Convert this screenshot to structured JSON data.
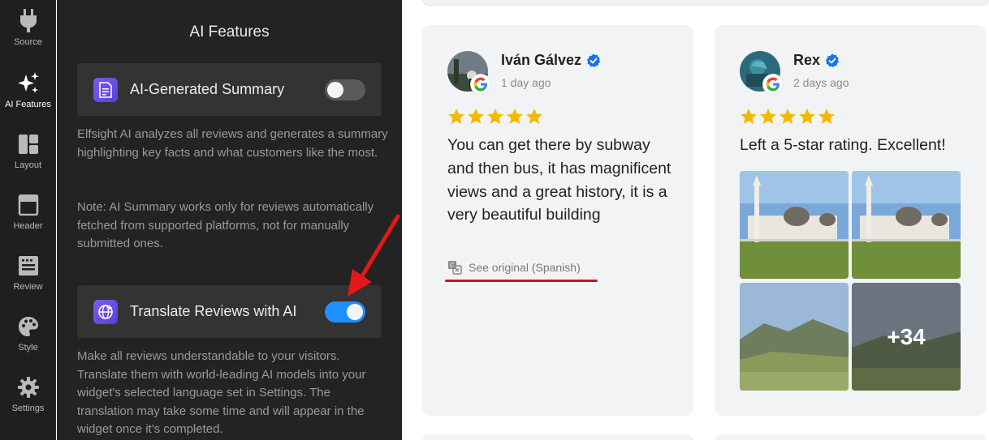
{
  "sidebar": {
    "items": [
      {
        "label": "Source",
        "icon": "plug-icon"
      },
      {
        "label": "AI Features",
        "icon": "sparkles-icon",
        "active": true
      },
      {
        "label": "Layout",
        "icon": "layout-grid-icon"
      },
      {
        "label": "Header",
        "icon": "header-window-icon"
      },
      {
        "label": "Review",
        "icon": "review-list-icon"
      },
      {
        "label": "Style",
        "icon": "palette-icon"
      },
      {
        "label": "Settings",
        "icon": "gear-icon"
      }
    ]
  },
  "panel": {
    "title": "AI Features",
    "features": [
      {
        "label": "AI-Generated Summary",
        "icon": "document-sparkle-icon",
        "enabled": false,
        "description": "Elfsight AI analyzes all reviews and generates a summary highlighting key facts and what customers like the most.",
        "note": "Note: AI Summary works only for reviews automatically fetched from supported platforms, not for manually submitted ones."
      },
      {
        "label": "Translate Reviews with AI",
        "icon": "globe-sparkle-icon",
        "enabled": true,
        "description": "Make all reviews understandable to your visitors. Translate them with world-leading AI models into your widget's selected language set in Settings. The translation may take some time and will appear in the widget once it's completed."
      }
    ]
  },
  "reviews": [
    {
      "name": "Iván Gálvez",
      "date": "1 day ago",
      "rating": 5,
      "text": "You can get there by subway and then bus, it has magnificent views and a great history, it is a very beautiful building",
      "see_original": "See original (Spanish)",
      "source_icon": "google-icon"
    },
    {
      "name": "Rex",
      "date": "2 days ago",
      "rating": 5,
      "text": "Left a 5-star rating. Excellent!",
      "more_photos": "+34",
      "source_icon": "google-icon"
    }
  ],
  "colors": {
    "accent": "#1e90ff",
    "star": "#f5b800",
    "verified": "#1a73e8",
    "highlight": "#c8102e"
  }
}
